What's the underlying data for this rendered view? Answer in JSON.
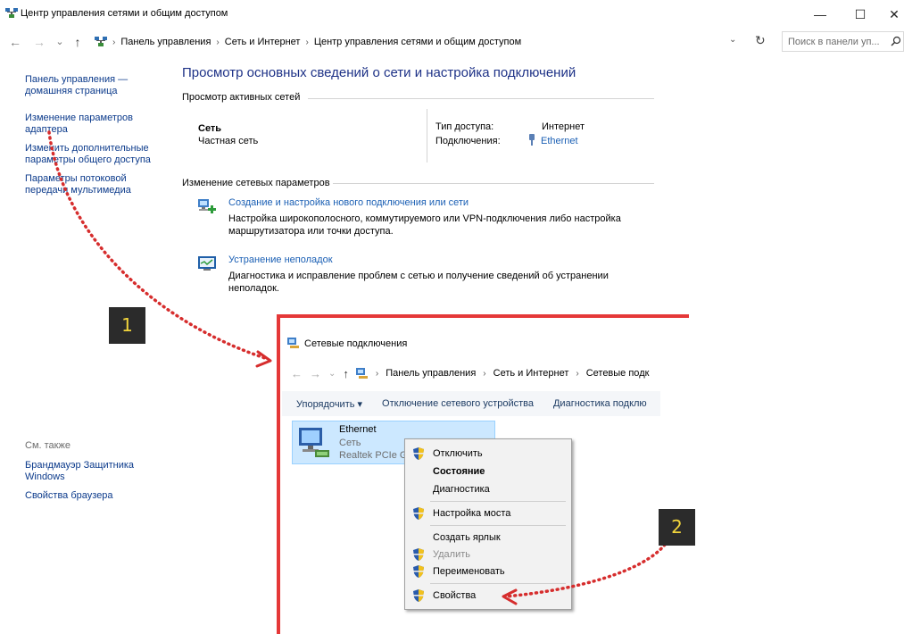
{
  "window": {
    "title": "Центр управления сетями и общим доступом",
    "controls": {
      "minimize": "—",
      "maximize": "☐",
      "close": "✕"
    }
  },
  "address": {
    "back": "←",
    "forward": "→",
    "history": "⌄",
    "up": "↑",
    "separator": "›",
    "crumbs": [
      "Панель управления",
      "Сеть и Интернет",
      "Центр управления сетями и общим доступом"
    ],
    "dropdown": "⌄",
    "refresh": "↻",
    "search_placeholder": "Поиск в панели уп..."
  },
  "sidebar": {
    "links": [
      "Панель управления —\nдомашняя страница",
      "Изменение параметров\nадаптера",
      "Изменить дополнительные\nпараметры общего доступа",
      "Параметры потоковой\nпередачи мультимедиа"
    ],
    "see_also": "См. также",
    "see_also_links": [
      "Брандмауэр Защитника\nWindows",
      "Свойства браузера"
    ]
  },
  "main": {
    "title": "Просмотр основных сведений о сети и настройка подключений",
    "active_networks_header": "Просмотр активных сетей",
    "network": {
      "name": "Сеть",
      "type": "Частная сеть",
      "access_type_label": "Тип доступа:",
      "access_type_value": "Интернет",
      "connections_label": "Подключения:",
      "connections_value": "Ethernet"
    },
    "change_settings_header": "Изменение сетевых параметров",
    "tasks": [
      {
        "link": "Создание и настройка нового подключения или сети",
        "desc": "Настройка широкополосного, коммутируемого или VPN-подключения либо настройка\nмаршрутизатора или точки доступа."
      },
      {
        "link": "Устранение неполадок",
        "desc": "Диагностика и исправление проблем с сетью и получение сведений об устранении\nнеполадок."
      }
    ]
  },
  "inset": {
    "title": "Сетевые подключения",
    "crumbs": [
      "Панель управления",
      "Сеть и Интернет",
      "Сетевые подк"
    ],
    "commands": [
      "Упорядочить ▾",
      "Отключение сетевого устройства",
      "Диагностика подклю"
    ],
    "adapter": {
      "name": "Ethernet",
      "network": "Сеть",
      "device": "Realtek PCIe GI"
    },
    "context_menu": [
      "Отключить",
      "Состояние",
      "Диагностика",
      "Настройка моста",
      "Создать ярлык",
      "Удалить",
      "Переименовать",
      "Свойства"
    ]
  },
  "badges": {
    "step1": "1",
    "step2": "2"
  },
  "colors": {
    "accent_red": "#e53838",
    "dots": "#d62d2d",
    "link": "#1a5fb4",
    "title_blue": "#1e3287"
  }
}
